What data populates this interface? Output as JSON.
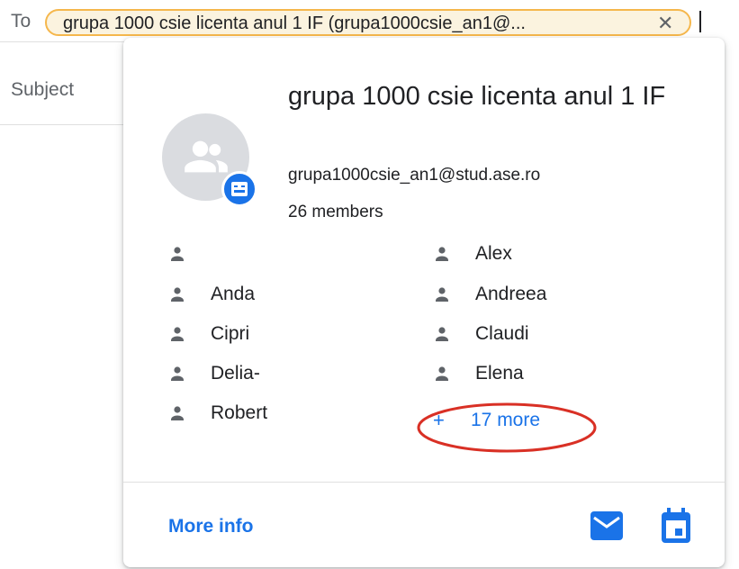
{
  "compose": {
    "to_label": "To",
    "recipient_chip": "grupa 1000 csie licenta anul 1 IF (grupa1000csie_an1@...",
    "chip_close": "✕",
    "subject_label": "Subject"
  },
  "group_card": {
    "name": "grupa 1000 csie licenta anul 1 IF",
    "email": "grupa1000csie_an1@stud.ase.ro",
    "member_count": "26 members",
    "members": [
      {
        "name": ""
      },
      {
        "name": "Alex"
      },
      {
        "name": "Anda"
      },
      {
        "name": "Andreea"
      },
      {
        "name": "Cipri"
      },
      {
        "name": "Claudi"
      },
      {
        "name": "Delia-"
      },
      {
        "name": "Elena"
      },
      {
        "name": "Robert"
      }
    ],
    "more_plus": "+",
    "more_link": "17 more",
    "more_info": "More info",
    "icons": {
      "avatar": "group-avatar-icon",
      "badge": "google-group-badge-icon",
      "member": "person-icon",
      "mail": "email-icon",
      "calendar": "calendar-icon"
    },
    "colors": {
      "accent": "#1a73e8",
      "highlight": "#d93025",
      "chip_border": "#f5b74c"
    }
  }
}
